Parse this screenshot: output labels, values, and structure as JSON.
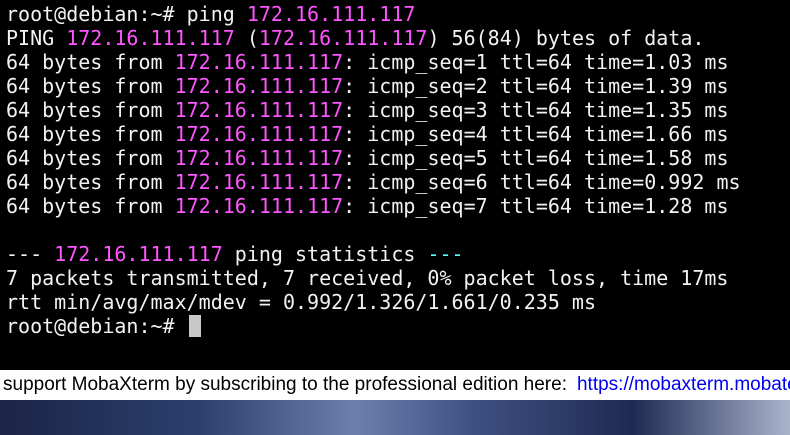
{
  "prompt": "root@debian:~#",
  "command": {
    "cmd": "ping",
    "host": "172.16.111.117"
  },
  "header": {
    "prefix": "PING",
    "host": "172.16.111.117",
    "open": "(",
    "host2": "172.16.111.117",
    "rest": ") 56(84) bytes of data."
  },
  "replies": [
    {
      "prefix": "64 bytes from",
      "ip": "172.16.111.117",
      "rest": ": icmp_seq=1 ttl=64 time=1.03 ms"
    },
    {
      "prefix": "64 bytes from",
      "ip": "172.16.111.117",
      "rest": ": icmp_seq=2 ttl=64 time=1.39 ms"
    },
    {
      "prefix": "64 bytes from",
      "ip": "172.16.111.117",
      "rest": ": icmp_seq=3 ttl=64 time=1.35 ms"
    },
    {
      "prefix": "64 bytes from",
      "ip": "172.16.111.117",
      "rest": ": icmp_seq=4 ttl=64 time=1.66 ms"
    },
    {
      "prefix": "64 bytes from",
      "ip": "172.16.111.117",
      "rest": ": icmp_seq=5 ttl=64 time=1.58 ms"
    },
    {
      "prefix": "64 bytes from",
      "ip": "172.16.111.117",
      "rest": ": icmp_seq=6 ttl=64 time=0.992 ms"
    },
    {
      "prefix": "64 bytes from",
      "ip": "172.16.111.117",
      "rest": ": icmp_seq=7 ttl=64 time=1.28 ms"
    }
  ],
  "stats": {
    "lead": "---",
    "host": "172.16.111.117",
    "label": "ping statistics",
    "trail": "---",
    "summary": "7 packets transmitted, 7 received, 0% packet loss, time 17ms",
    "rtt": "rtt min/avg/max/mdev = 0.992/1.326/1.661/0.235 ms"
  },
  "banner": {
    "text": "support MobaXterm by subscribing to the professional edition here:",
    "link": "https://mobaxterm.mobatek.net"
  },
  "colors": {
    "ip": "#ff55ff",
    "dashes": "#55ffff",
    "text": "#f2f2f2",
    "background": "#000000"
  }
}
